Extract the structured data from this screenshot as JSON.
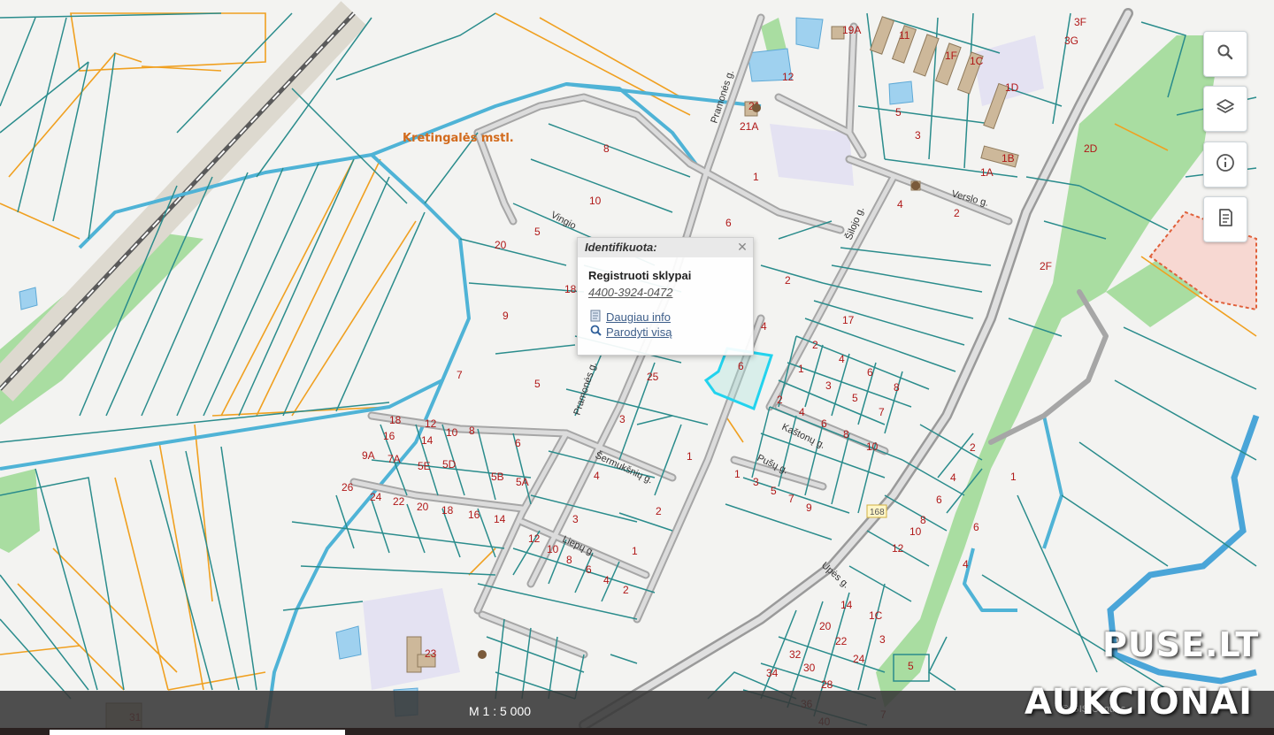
{
  "map": {
    "place_label": "Kretingalės mstl.",
    "streets": [
      "Pramonės g.",
      "Vingio",
      "Verslo g.",
      "Šermukšnių g.",
      "Kaštonų g.",
      "Pušų g.",
      "Liepų g.",
      "Upės g.",
      "Šilojo g."
    ],
    "road_badge": "168",
    "plot_numbers": [
      "8",
      "10",
      "5",
      "20",
      "18",
      "9",
      "7",
      "5",
      "25",
      "3",
      "1",
      "4",
      "3",
      "2",
      "1",
      "6",
      "1",
      "2",
      "17",
      "4",
      "2",
      "4",
      "6",
      "8",
      "1",
      "3",
      "5",
      "7",
      "2",
      "4",
      "6",
      "8",
      "10",
      "1",
      "3",
      "5",
      "7",
      "9",
      "12",
      "21",
      "21A",
      "11",
      "1F",
      "1C",
      "1D",
      "1B",
      "1A",
      "2",
      "2D",
      "2F",
      "3",
      "4",
      "19A",
      "3F",
      "3G",
      "5",
      "18",
      "12",
      "10",
      "8",
      "16",
      "14",
      "9A",
      "7A",
      "5E",
      "5D",
      "5A",
      "5B",
      "6",
      "26",
      "24",
      "22",
      "20",
      "18",
      "16",
      "14",
      "12",
      "10",
      "8",
      "6",
      "4",
      "2",
      "23",
      "31",
      "14",
      "1C",
      "20",
      "22",
      "24",
      "32",
      "30",
      "28",
      "34",
      "36",
      "40",
      "8",
      "6",
      "4",
      "2",
      "6",
      "10",
      "12",
      "4",
      "7",
      "5",
      "3",
      "1"
    ]
  },
  "toolbar": {
    "buttons": [
      {
        "icon": "search-icon"
      },
      {
        "icon": "layers-icon"
      },
      {
        "icon": "info-icon"
      },
      {
        "icon": "legend-icon"
      }
    ]
  },
  "popup": {
    "title": "Identifikuota:",
    "subtitle": "Registruoti sklypai",
    "parcel_id": "4400-3924-0472",
    "more_info": "Daugiau info",
    "show_all": "Parodyti visą"
  },
  "footer": {
    "scale": "M 1 : 5 000",
    "attribution": "© GIS-Centras"
  },
  "watermark": {
    "line1": "PUSE.LT",
    "line2": "AUKCIONAI"
  },
  "colors": {
    "parcel_line": "#2a8c8c",
    "municipal_boundary": "#4fb3d6",
    "orange_line": "#f0a020",
    "road_fill": "#c8c8c8",
    "green_area": "#a8dca0",
    "highlight": "#22d3ee",
    "plot_number": "#b01818"
  }
}
